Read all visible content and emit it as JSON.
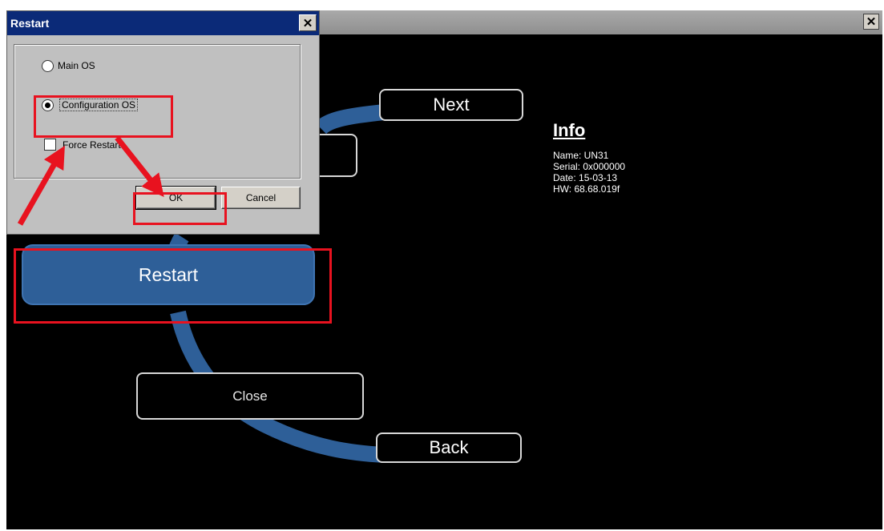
{
  "dialog": {
    "title": "Restart",
    "close_glyph": "✕",
    "options": {
      "main_os": "Main OS",
      "configuration_os": "Configuration OS",
      "selected": "configuration_os"
    },
    "force_restart": "Force Restart",
    "ok": "OK",
    "cancel": "Cancel"
  },
  "main": {
    "close_glyph": "✕",
    "buttons": {
      "next": "Next",
      "restart": "Restart",
      "close": "Close",
      "back": "Back"
    },
    "info": {
      "title": "Info",
      "lines": [
        "Name: UN31",
        "Serial: 0x000000",
        "Date: 15-03-13",
        "HW: 68.68.019f"
      ]
    }
  },
  "colors": {
    "arc": "#2e5f98",
    "highlight": "#e8121f",
    "dialog_title": "#0b2a78",
    "panel": "#c0c0c0"
  },
  "icons": [
    "close-icon",
    "radio-button",
    "checkbox",
    "arrow-icon"
  ]
}
